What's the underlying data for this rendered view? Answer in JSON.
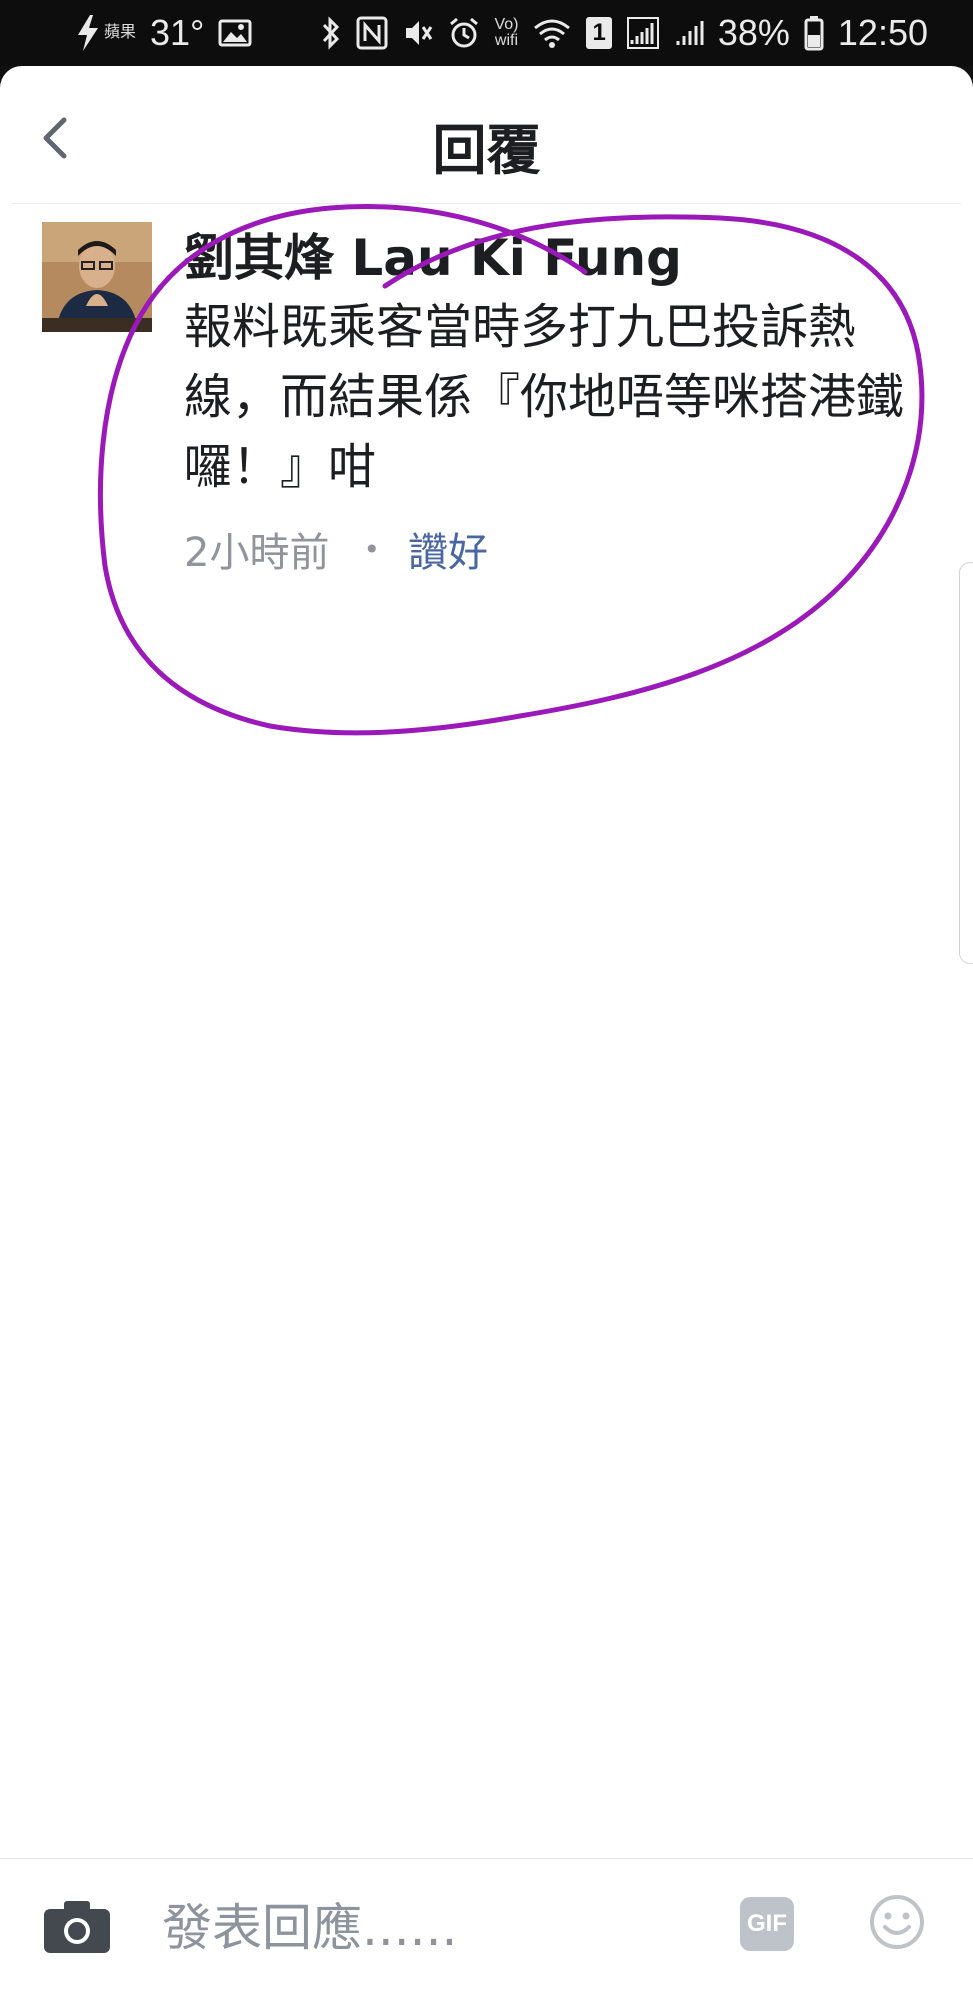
{
  "status_bar": {
    "carrier_logo": "蘋果",
    "temperature": "31°",
    "battery": "38%",
    "time": "12:50",
    "volte": "Vo)",
    "wifi_label": "wifi",
    "sim_badge": "1",
    "icons": [
      "lightning-icon",
      "image-icon",
      "bluetooth-icon",
      "nfc-icon",
      "vibrate-icon",
      "alarm-icon",
      "wifi-icon",
      "signal-icon",
      "battery-icon"
    ]
  },
  "header": {
    "title": "回覆",
    "back_icon": "chevron-left-icon"
  },
  "comment": {
    "author": "劉其烽 Lau Ki Fung",
    "body": "報料既乘客當時多打九巴投訴熱線，而結果係『你地唔等咪搭港鐵囉！』咁",
    "time_ago": "2小時前",
    "separator": "•",
    "like_label": "讚好"
  },
  "composer": {
    "placeholder": "發表回應......",
    "gif_label": "GIF",
    "camera_icon": "camera-icon",
    "emoji_icon": "smiley-icon"
  },
  "colors": {
    "text": "#1c1e21",
    "meta": "#90949c",
    "link": "#4b67a1",
    "annotation": "#9a19b8",
    "status_bar": "#0d0d0d"
  }
}
